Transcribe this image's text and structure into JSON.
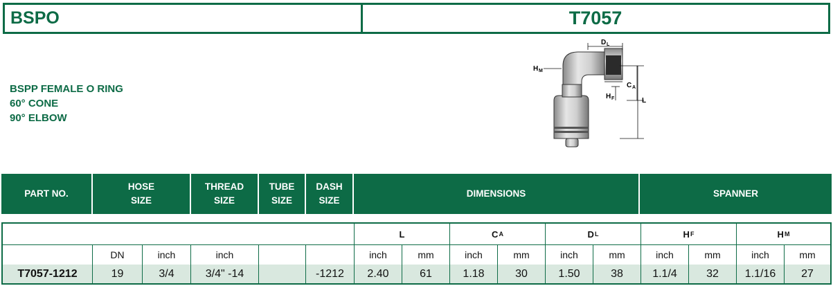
{
  "title": {
    "family": "BSPO",
    "part_series": "T7057"
  },
  "description": [
    "BSPP FEMALE O RING",
    "60° CONE",
    "90° ELBOW"
  ],
  "drawing": {
    "labels": {
      "dl_main": "D",
      "dl_sub": "L",
      "hm_main": "H",
      "hm_sub": "M",
      "ca_main": "C",
      "ca_sub": "A",
      "hf_main": "H",
      "hf_sub": "F",
      "l": "L"
    }
  },
  "header": {
    "part_no": "PART NO.",
    "hose_size_1": "HOSE",
    "hose_size_2": "SIZE",
    "thread_size_1": "THREAD",
    "thread_size_2": "SIZE",
    "tube_size_1": "TUBE",
    "tube_size_2": "SIZE",
    "dash_size_1": "DASH",
    "dash_size_2": "SIZE",
    "dimensions": "DIMENSIONS",
    "spanner": "SPANNER"
  },
  "dim_groups": {
    "l": "L",
    "ca_main": "C",
    "ca_sub": "A",
    "dl_main": "D",
    "dl_sub": "L",
    "hf_main": "H",
    "hf_sub": "F",
    "hm_main": "H",
    "hm_sub": "M"
  },
  "units": {
    "dn": "DN",
    "hose_inch": "inch",
    "thread_inch": "inch",
    "l_inch": "inch",
    "l_mm": "mm",
    "ca_inch": "inch",
    "ca_mm": "mm",
    "dl_inch": "inch",
    "dl_mm": "mm",
    "hf_inch": "inch",
    "hf_mm": "mm",
    "hm_inch": "inch",
    "hm_mm": "mm"
  },
  "rows": [
    {
      "part_no": "T7057-1212",
      "dn": "19",
      "hose_inch": "3/4",
      "thread": "3/4\" -14",
      "tube": "",
      "dash": "-1212",
      "l_inch": "2.40",
      "l_mm": "61",
      "ca_inch": "1.18",
      "ca_mm": "30",
      "dl_inch": "1.50",
      "dl_mm": "38",
      "hf_inch": "1.1/4",
      "hf_mm": "32",
      "hm_inch": "1.1/16",
      "hm_mm": "27"
    }
  ],
  "colors": {
    "brand_green": "#0d6b46",
    "row_highlight": "#d9e8df"
  }
}
